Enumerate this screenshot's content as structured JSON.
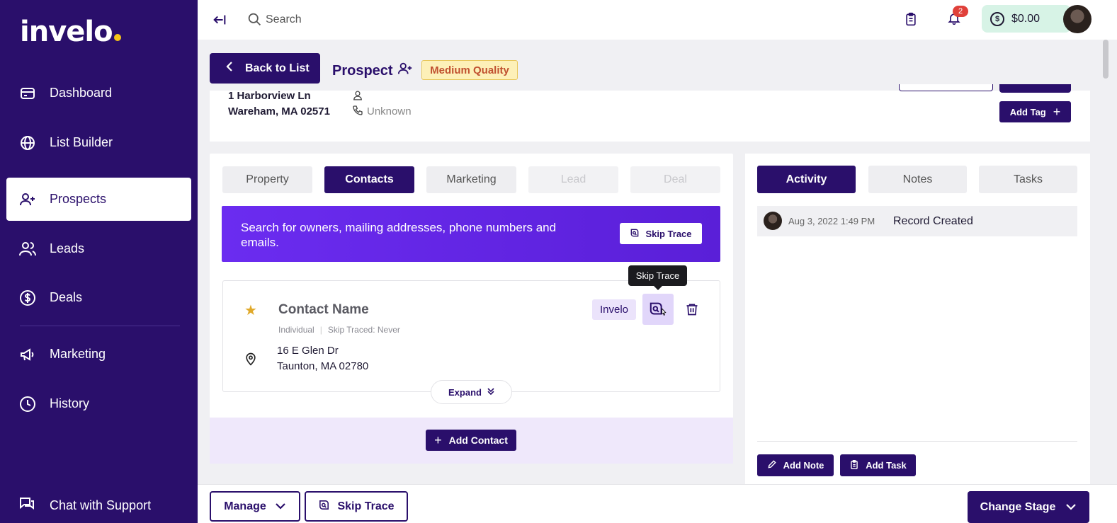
{
  "brand": {
    "logo_text": "invelo",
    "accent_dot": "#f5c518",
    "primary": "#2a0f6b"
  },
  "sidebar": {
    "items": [
      {
        "label": "Dashboard",
        "icon": "card-icon"
      },
      {
        "label": "List Builder",
        "icon": "globe-icon"
      },
      {
        "label": "Prospects",
        "icon": "add-user-icon",
        "active": true
      },
      {
        "label": "Leads",
        "icon": "users-icon"
      },
      {
        "label": "Deals",
        "icon": "dollar-icon"
      },
      {
        "label": "Marketing",
        "icon": "megaphone-icon"
      },
      {
        "label": "History",
        "icon": "clock-icon"
      }
    ],
    "support_label": "Chat with Support"
  },
  "topbar": {
    "search_label": "Search",
    "notification_count": "2",
    "wallet_balance": "$0.00"
  },
  "header": {
    "back_label": "Back to List",
    "title": "Prospect",
    "quality_badge": "Medium Quality"
  },
  "property": {
    "address_line1": "1 Harborview Ln",
    "address_line2": "Wareham, MA 02571",
    "phone_status": "Unknown",
    "add_tag_label": "Add Tag"
  },
  "tabs": [
    {
      "label": "Property",
      "state": "normal"
    },
    {
      "label": "Contacts",
      "state": "active"
    },
    {
      "label": "Marketing",
      "state": "normal"
    },
    {
      "label": "Lead",
      "state": "disabled"
    },
    {
      "label": "Deal",
      "state": "disabled"
    }
  ],
  "promo": {
    "text": "Search for owners, mailing addresses, phone numbers and emails.",
    "button_label": "Skip Trace"
  },
  "tooltip": "Skip Trace",
  "contact": {
    "name": "Contact Name",
    "type": "Individual",
    "skip_traced": "Skip Traced: Never",
    "source_chip": "Invelo",
    "address_line1": "16 E Glen Dr",
    "address_line2": "Taunton, MA 02780",
    "expand_label": "Expand"
  },
  "add_contact_label": "Add Contact",
  "right_tabs": [
    {
      "label": "Activity",
      "state": "active"
    },
    {
      "label": "Notes",
      "state": "normal"
    },
    {
      "label": "Tasks",
      "state": "normal"
    }
  ],
  "activity": [
    {
      "date": "Aug 3, 2022 1:49 PM",
      "text": "Record Created"
    }
  ],
  "right_actions": {
    "add_note": "Add Note",
    "add_task": "Add Task"
  },
  "bottom": {
    "manage_label": "Manage",
    "skip_trace_label": "Skip Trace",
    "change_stage_label": "Change Stage"
  }
}
